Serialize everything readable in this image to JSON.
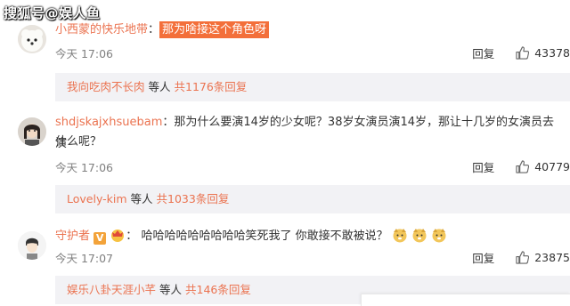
{
  "watermark": "搜狐号@娱人鱼",
  "colors": {
    "accent": "#eb7350",
    "highlight": "#f36f3a",
    "sub_bg": "#f2f2f5",
    "meta": "#808080"
  },
  "comments": [
    {
      "username": "小西蒙的快乐地带",
      "text": "那为啥接这个角色呀",
      "time": "今天 17:06",
      "reply_label": "回复",
      "likes": "43378",
      "sub_user": "我向吃肉不长肉",
      "sub_mid": "等人",
      "sub_count": "共1176条回复"
    },
    {
      "username": "shdjskajxhsuebam",
      "text": "那为什么要演14岁的少女呢？38岁女演员演14岁，那让十几岁的女演员去演",
      "text2": "什么呢？",
      "time": "今天 17:06",
      "reply_label": "回复",
      "likes": "40779",
      "sub_user": "Lovely-kim",
      "sub_mid": "等人",
      "sub_count": "共1033条回复"
    },
    {
      "username": "守护者",
      "badge": "V",
      "text": "哈哈哈哈哈哈哈哈哈笑死我了 你敢接不敢被说？",
      "time": "今天 17:07",
      "reply_label": "回复",
      "likes": "23875",
      "sub_user": "娱乐八卦天涯小芊",
      "sub_mid": "等人",
      "sub_count": "共146条回复"
    }
  ],
  "icons": {
    "like": "thumbs-up-icon",
    "avatar_badge": "crown-emoji-icon",
    "emoji": "dog-face-icon"
  }
}
